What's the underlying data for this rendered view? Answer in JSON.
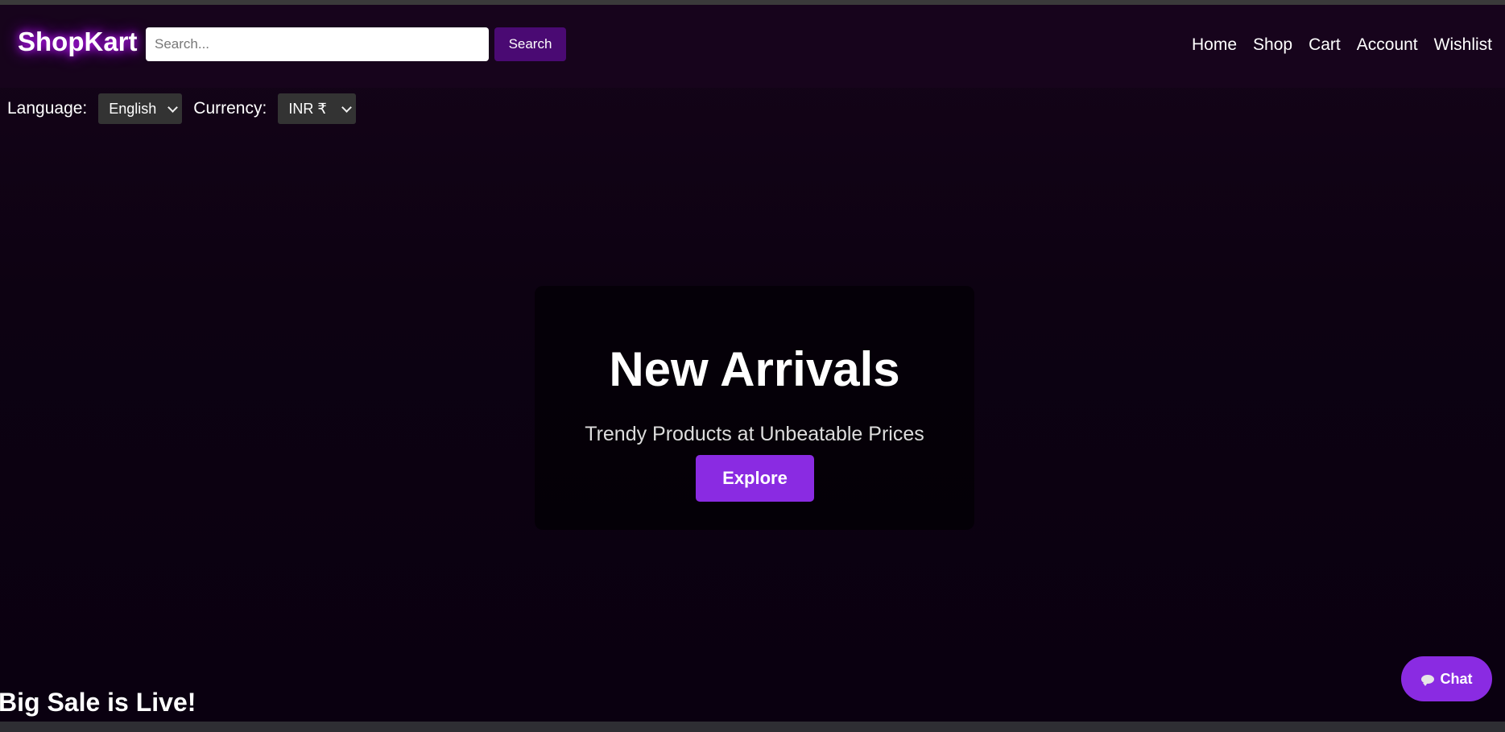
{
  "header": {
    "logo": "ShopKart",
    "search_placeholder": "Search...",
    "search_value": "",
    "search_button": "Search",
    "nav": [
      "Home",
      "Shop",
      "Cart",
      "Account",
      "Wishlist"
    ]
  },
  "settings": {
    "language_label": "Language:",
    "language_value": "English",
    "currency_label": "Currency:",
    "currency_value": "INR ₹"
  },
  "hero": {
    "title": "New Arrivals",
    "subtitle": "Trendy Products at Unbeatable Prices",
    "button": "Explore"
  },
  "chat": {
    "label": "Chat",
    "icon": "chat-bubble-icon"
  },
  "ticker": {
    "text": "Big Sale is Live!"
  },
  "colors": {
    "background": "#0d0212",
    "header_background": "#17041c",
    "accent": "#8a2be2",
    "search_button": "#4a0a73",
    "logo_glow": "#c31cff"
  }
}
